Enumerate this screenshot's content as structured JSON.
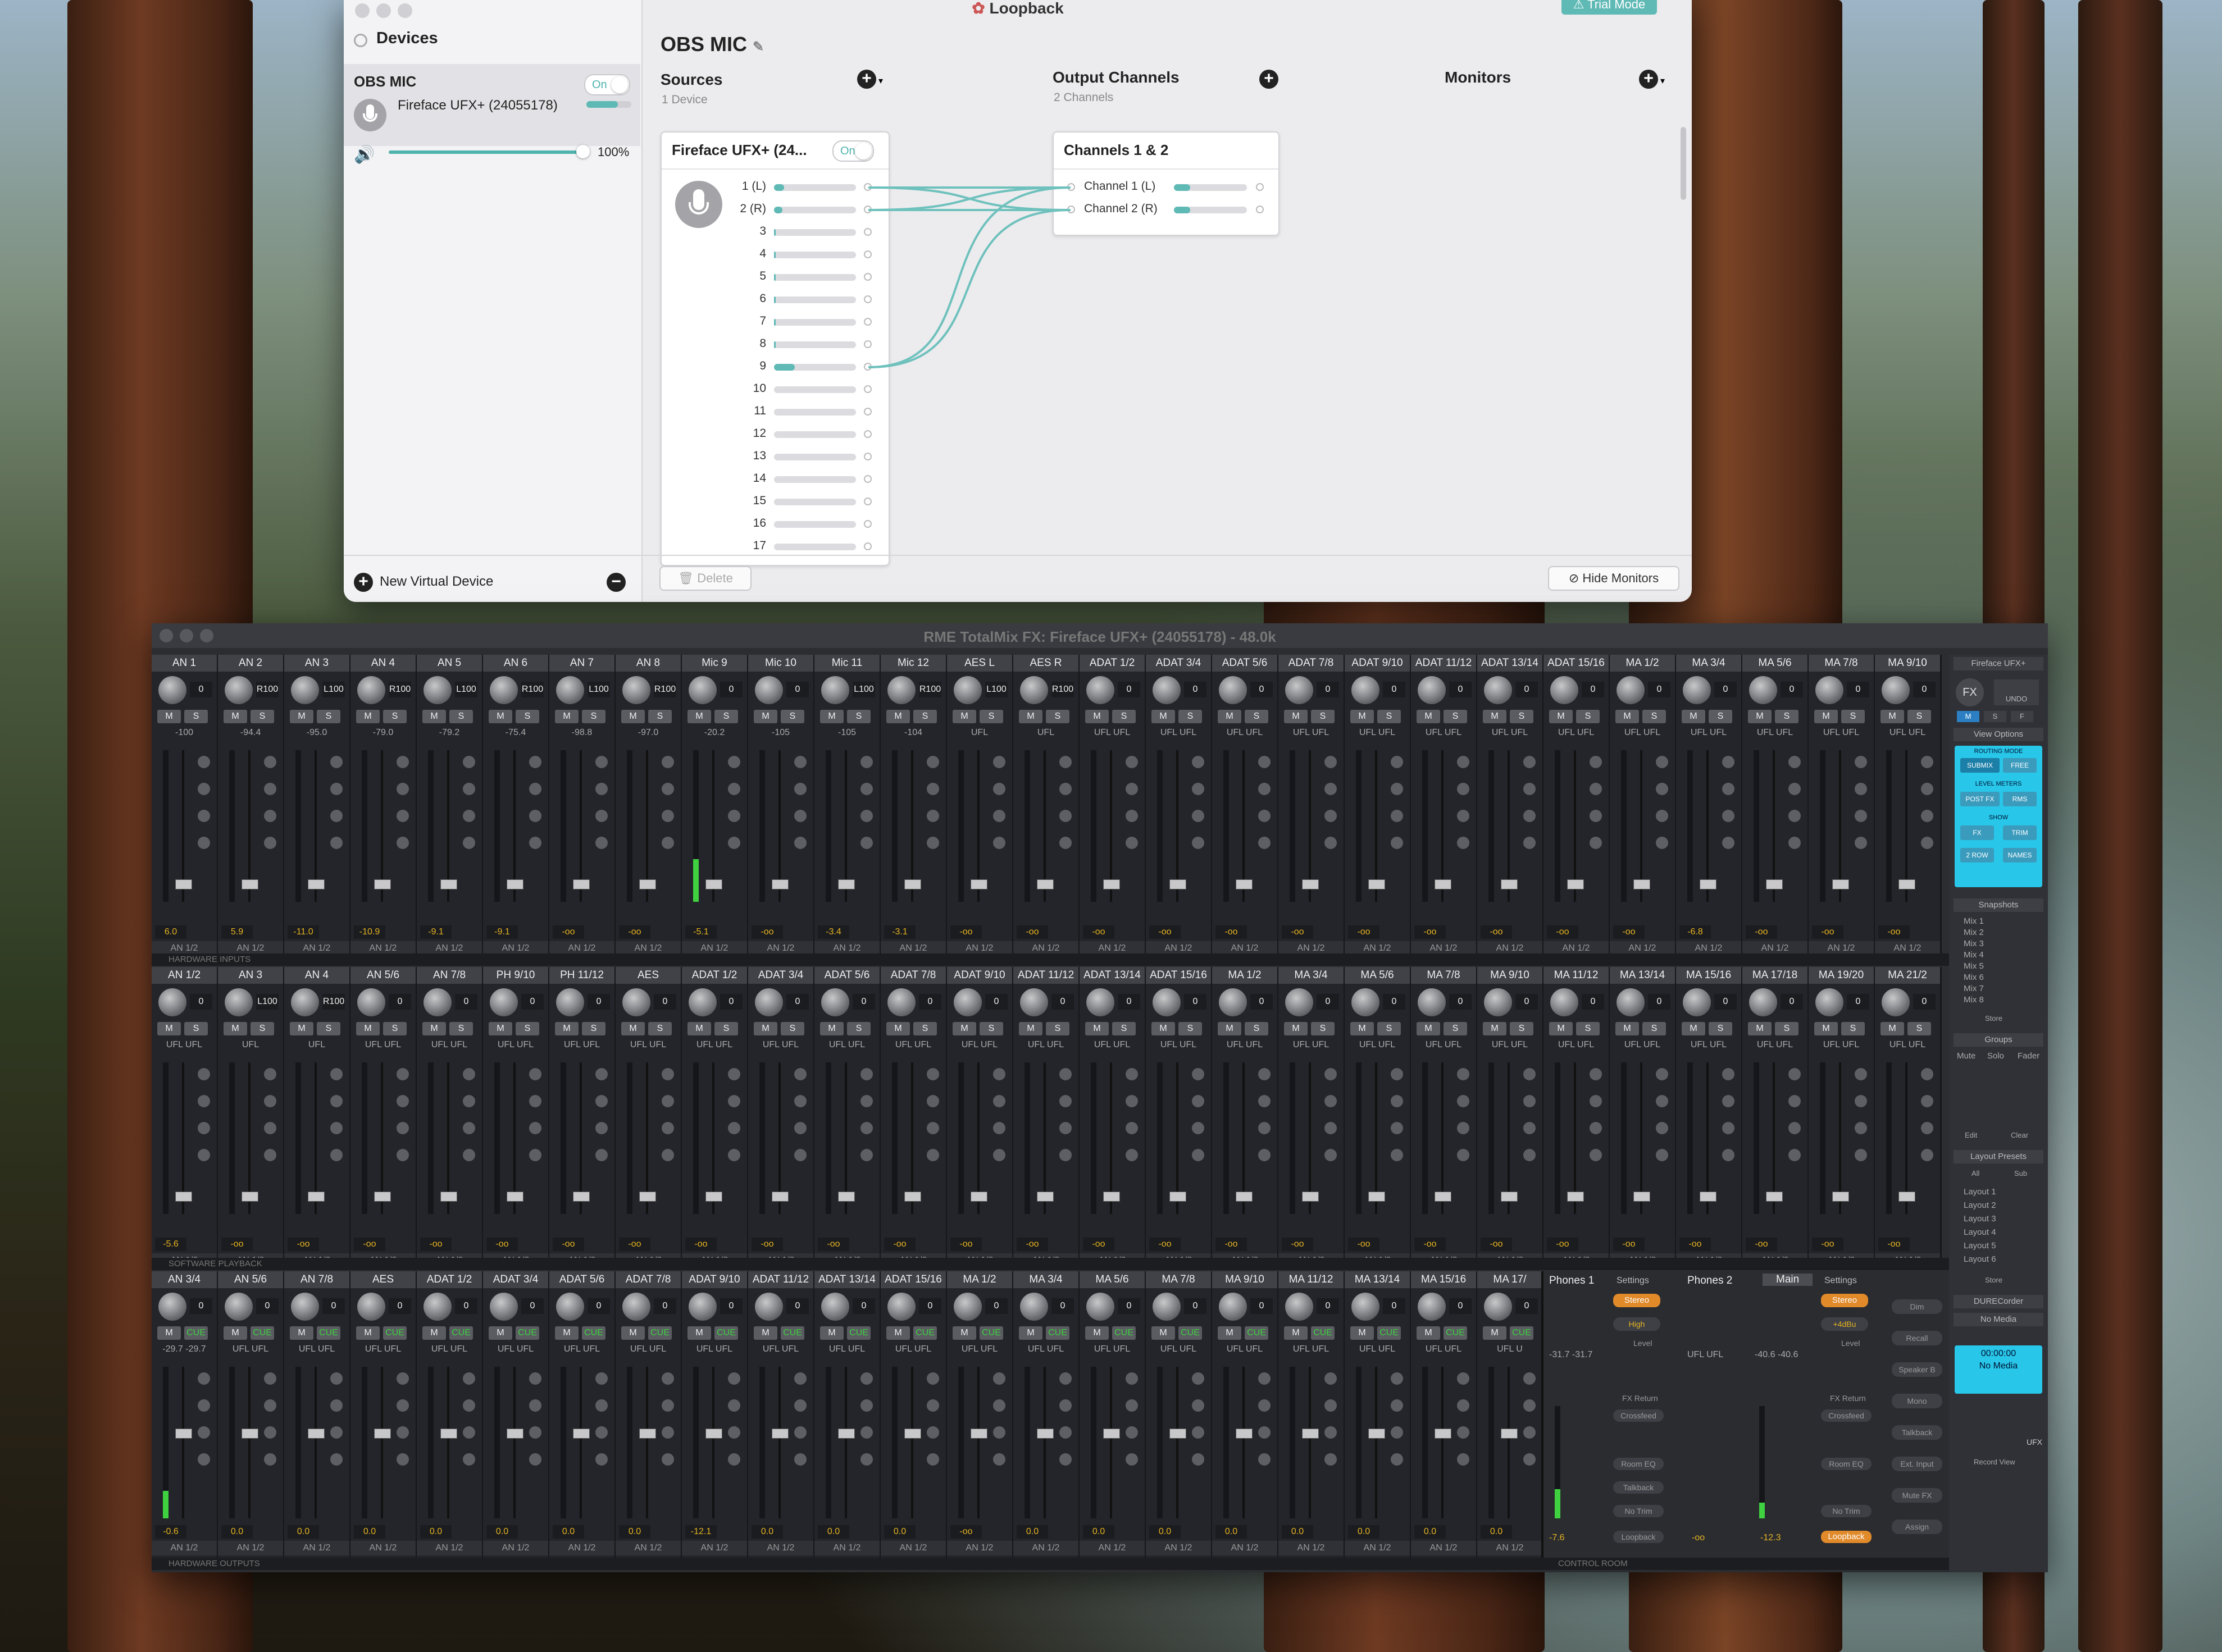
{
  "loopback": {
    "window_title": "Loopback",
    "trial_badge": "Trial Mode",
    "sidebar_title": "Devices",
    "device": {
      "name": "OBS MIC",
      "toggle": "On",
      "source": "Fireface UFX+ (24055178)",
      "volume_pct": "100%",
      "volume": 1.0
    },
    "new_device": "New Virtual Device",
    "device_title": "OBS MIC",
    "sources": {
      "title": "Sources",
      "sub": "1 Device"
    },
    "outputs": {
      "title": "Output Channels",
      "sub": "2 Channels"
    },
    "monitors": {
      "title": "Monitors"
    },
    "source_box": {
      "title": "Fireface UFX+ (24...",
      "toggle": "On",
      "channels": [
        "1 (L)",
        "2 (R)",
        "3",
        "4",
        "5",
        "6",
        "7",
        "8",
        "9",
        "10",
        "11",
        "12",
        "13",
        "14",
        "15",
        "16",
        "17"
      ],
      "levels": [
        0.12,
        0.1,
        0.02,
        0.02,
        0.02,
        0.02,
        0.02,
        0.02,
        0.25,
        0.0,
        0.0,
        0.0,
        0.0,
        0.0,
        0.0,
        0.0,
        0.0
      ]
    },
    "output_box": {
      "title": "Channels 1 & 2",
      "channels": [
        "Channel 1 (L)",
        "Channel 2 (R)"
      ],
      "levels": [
        0.22,
        0.22
      ]
    },
    "delete": "Delete",
    "hide_monitors": "Hide Monitors"
  },
  "totalmix": {
    "window_title": "RME TotalMix FX: Fireface UFX+ (24055178) - 48.0k",
    "section_hw_inputs": "HARDWARE INPUTS",
    "section_sw_playback": "SOFTWARE PLAYBACK",
    "section_hw_outputs": "HARDWARE OUTPUTS",
    "section_control_room": "CONTROL ROOM",
    "route_label": "AN 1/2",
    "row1": {
      "names": [
        "AN 1",
        "AN 2",
        "AN 3",
        "AN 4",
        "AN 5",
        "AN 6",
        "AN 7",
        "AN 8",
        "Mic 9",
        "Mic 10",
        "Mic 11",
        "Mic 12",
        "AES L",
        "AES R",
        "ADAT 1/2",
        "ADAT 3/4",
        "ADAT 5/6",
        "ADAT 7/8",
        "ADAT 9/10",
        "ADAT 11/12",
        "ADAT 13/14",
        "ADAT 15/16",
        "MA 1/2",
        "MA 3/4",
        "MA 5/6",
        "MA 7/8",
        "MA 9/10"
      ],
      "knobs": [
        "0",
        "R100",
        "L100",
        "R100",
        "L100",
        "R100",
        "L100",
        "R100",
        "0",
        "0",
        "L100",
        "R100",
        "L100",
        "R100",
        "0",
        "0",
        "0",
        "0",
        "0",
        "0",
        "0",
        "0",
        "0",
        "0",
        "0",
        "0",
        "0"
      ],
      "readings": [
        "-100",
        "-94.4",
        "-95.0",
        "-79.0",
        "-79.2",
        "-75.4",
        "-98.8",
        "-97.0",
        "-20.2",
        "-105",
        "-105",
        "-104",
        "UFL",
        "UFL",
        "UFL UFL",
        "UFL UFL",
        "UFL UFL",
        "UFL UFL",
        "UFL UFL",
        "UFL UFL",
        "UFL UFL",
        "UFL UFL",
        "UFL UFL",
        "UFL UFL",
        "UFL UFL",
        "UFL UFL",
        "UFL UFL"
      ],
      "values": [
        "6.0",
        "5.9",
        "-11.0",
        "-10.9",
        "-9.1",
        "-9.1",
        "-oo",
        "-oo",
        "-5.1",
        "-oo",
        "-3.4",
        "-3.1",
        "-oo",
        "-oo",
        "-oo",
        "-oo",
        "-oo",
        "-oo",
        "-oo",
        "-oo",
        "-oo",
        "-oo",
        "-oo",
        "-6.8",
        "-oo",
        "-oo",
        "-oo"
      ],
      "meter": [
        0,
        0,
        0,
        0,
        0,
        0,
        0,
        0,
        0.28,
        0,
        0,
        0,
        0,
        0,
        0,
        0,
        0,
        0,
        0,
        0,
        0,
        0,
        0,
        0,
        0,
        0,
        0
      ]
    },
    "row2": {
      "names": [
        "AN 1/2",
        "AN 3",
        "AN 4",
        "AN 5/6",
        "AN 7/8",
        "PH 9/10",
        "PH 11/12",
        "AES",
        "ADAT 1/2",
        "ADAT 3/4",
        "ADAT 5/6",
        "ADAT 7/8",
        "ADAT 9/10",
        "ADAT 11/12",
        "ADAT 13/14",
        "ADAT 15/16",
        "MA 1/2",
        "MA 3/4",
        "MA 5/6",
        "MA 7/8",
        "MA 9/10",
        "MA 11/12",
        "MA 13/14",
        "MA 15/16",
        "MA 17/18",
        "MA 19/20",
        "MA 21/2"
      ],
      "knobs": [
        "0",
        "L100",
        "R100",
        "0",
        "0",
        "0",
        "0",
        "0",
        "0",
        "0",
        "0",
        "0",
        "0",
        "0",
        "0",
        "0",
        "0",
        "0",
        "0",
        "0",
        "0",
        "0",
        "0",
        "0",
        "0",
        "0",
        "0"
      ],
      "readings": [
        "UFL UFL",
        "UFL",
        "UFL",
        "UFL UFL",
        "UFL UFL",
        "UFL UFL",
        "UFL UFL",
        "UFL UFL",
        "UFL UFL",
        "UFL UFL",
        "UFL UFL",
        "UFL UFL",
        "UFL UFL",
        "UFL UFL",
        "UFL UFL",
        "UFL UFL",
        "UFL UFL",
        "UFL UFL",
        "UFL UFL",
        "UFL UFL",
        "UFL UFL",
        "UFL UFL",
        "UFL UFL",
        "UFL UFL",
        "UFL UFL",
        "UFL UFL",
        "UFL UFL"
      ],
      "values": [
        "-5.6",
        "-oo",
        "-oo",
        "-oo",
        "-oo",
        "-oo",
        "-oo",
        "-oo",
        "-oo",
        "-oo",
        "-oo",
        "-oo",
        "-oo",
        "-oo",
        "-oo",
        "-oo",
        "-oo",
        "-oo",
        "-oo",
        "-oo",
        "-oo",
        "-oo",
        "-oo",
        "-oo",
        "-oo",
        "-oo",
        "-oo"
      ]
    },
    "row3": {
      "names": [
        "AN 3/4",
        "AN 5/6",
        "AN 7/8",
        "AES",
        "ADAT 1/2",
        "ADAT 3/4",
        "ADAT 5/6",
        "ADAT 7/8",
        "ADAT 9/10",
        "ADAT 11/12",
        "ADAT 13/14",
        "ADAT 15/16",
        "MA 1/2",
        "MA 3/4",
        "MA 5/6",
        "MA 7/8",
        "MA 9/10",
        "MA 11/12",
        "MA 13/14",
        "MA 15/16",
        "MA 17/"
      ],
      "readings": [
        "-29.7 -29.7",
        "UFL UFL",
        "UFL UFL",
        "UFL UFL",
        "UFL UFL",
        "UFL UFL",
        "UFL UFL",
        "UFL UFL",
        "UFL UFL",
        "UFL UFL",
        "UFL UFL",
        "UFL UFL",
        "UFL UFL",
        "UFL UFL",
        "UFL UFL",
        "UFL UFL",
        "UFL UFL",
        "UFL UFL",
        "UFL UFL",
        "UFL UFL",
        "UFL U"
      ],
      "values": [
        "-0.6",
        "0.0",
        "0.0",
        "0.0",
        "0.0",
        "0.0",
        "0.0",
        "0.0",
        "-12.1",
        "0.0",
        "0.0",
        "0.0",
        "-oo",
        "0.0",
        "0.0",
        "0.0",
        "0.0",
        "0.0",
        "0.0",
        "0.0",
        "0.0"
      ],
      "meter": [
        0.18,
        0,
        0,
        0,
        0,
        0,
        0,
        0,
        0,
        0,
        0,
        0,
        0,
        0,
        0,
        0,
        0,
        0,
        0,
        0,
        0
      ]
    },
    "control_room": {
      "phones1": {
        "name": "Phones 1",
        "reading": "-31.7 -31.7",
        "value": "-7.6"
      },
      "phones2": {
        "name": "Phones 2",
        "reading": "UFL UFL",
        "value": "-oo"
      },
      "main": {
        "name": "Main",
        "reading": "-40.6 -40.6",
        "value": "-12.3"
      },
      "settings": "Settings",
      "stereo": "Stereo",
      "high": "High",
      "gain": "+4dBu",
      "level": "Level",
      "fx_return": "FX Return",
      "crossfeed": "Crossfeed",
      "room_eq": "Room EQ",
      "talkback": "Talkback",
      "no_trim": "No Trim",
      "loopback": "Loopback",
      "buttons": [
        "Dim",
        "Recall",
        "Speaker B",
        "Mono",
        "Talkback",
        "Ext. Input",
        "Mute FX",
        "Assign"
      ]
    },
    "right_panel": {
      "device": "Fireface UFX+",
      "fx": "FX",
      "undo": "UNDO",
      "view_options": "View Options",
      "routing_mode": "ROUTING MODE",
      "submix": "SUBMIX",
      "free": "FREE",
      "level_meters": "LEVEL METERS",
      "post_fx": "POST FX",
      "rms": "RMS",
      "show": "SHOW",
      "fx_btn": "FX",
      "trim": "TRIM",
      "row2": "2 ROW",
      "names": "NAMES",
      "snapshots": "Snapshots",
      "mixes": [
        "Mix 1",
        "Mix 2",
        "Mix 3",
        "Mix 4",
        "Mix 5",
        "Mix 6",
        "Mix 7",
        "Mix 8"
      ],
      "store": "Store",
      "groups": "Groups",
      "group_cols": [
        "Mute",
        "Solo",
        "Fader"
      ],
      "edit": "Edit",
      "clear": "Clear",
      "layout_presets": "Layout Presets",
      "all": "All",
      "sub": "Sub",
      "layouts": [
        "Layout 1",
        "Layout 2",
        "Layout 3",
        "Layout 4",
        "Layout 5",
        "Layout 6"
      ],
      "durec": "DURECorder",
      "no_media": "No Media",
      "time": "00:00:00",
      "ufx": "UFX",
      "record_view": "Record View"
    }
  }
}
